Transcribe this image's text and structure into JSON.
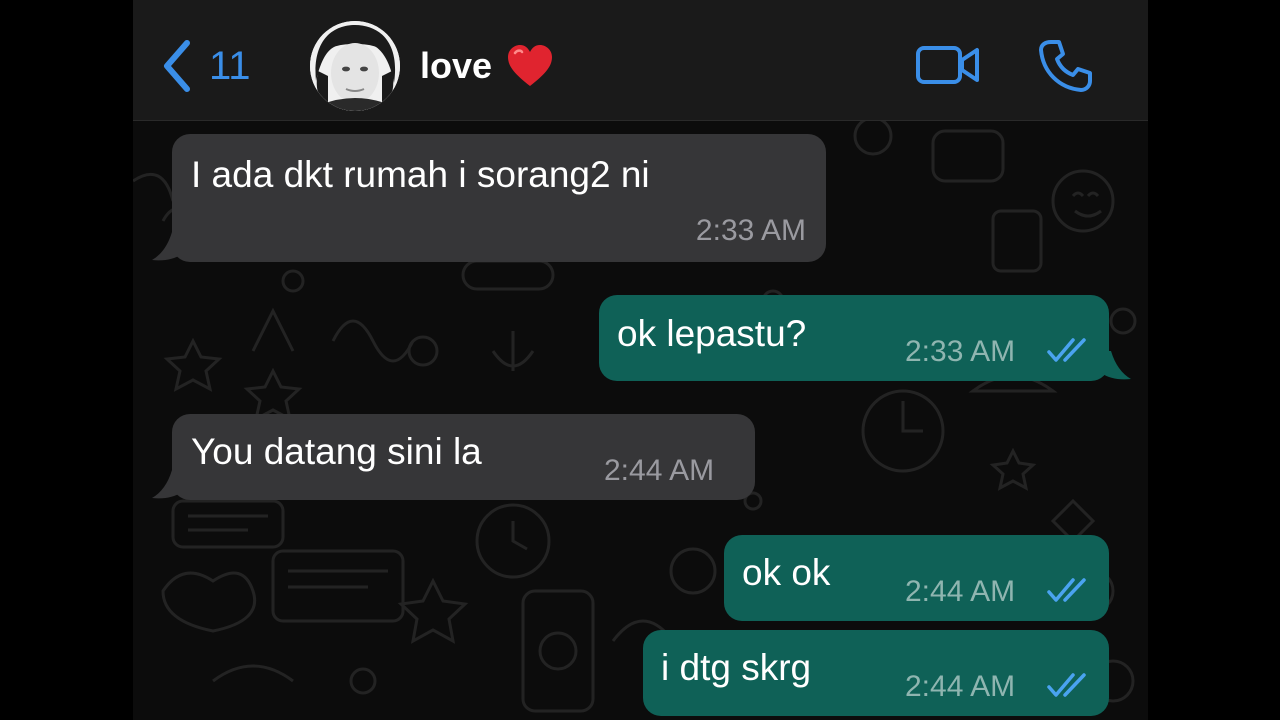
{
  "header": {
    "back_count": "11",
    "contact_name": "love",
    "icons": {
      "back": "chevron-left-icon",
      "heart": "red-heart-icon",
      "video": "video-call-icon",
      "call": "phone-call-icon"
    }
  },
  "colors": {
    "accent": "#3a8ee8",
    "incoming_bubble": "#363638",
    "outgoing_bubble": "#0f6157",
    "read_ticks": "#4aa3f0",
    "heart": "#e0242f"
  },
  "messages": [
    {
      "direction": "incoming",
      "text": "I ada dkt rumah i sorang2 ni",
      "time": "2:33 AM"
    },
    {
      "direction": "outgoing",
      "text": "ok lepastu?",
      "time": "2:33 AM",
      "status": "read"
    },
    {
      "direction": "incoming",
      "text": "You datang sini la",
      "time": "2:44 AM"
    },
    {
      "direction": "outgoing",
      "text": "ok ok",
      "time": "2:44 AM",
      "status": "read"
    },
    {
      "direction": "outgoing",
      "text": "i dtg skrg",
      "time": "2:44 AM",
      "status": "read"
    }
  ]
}
